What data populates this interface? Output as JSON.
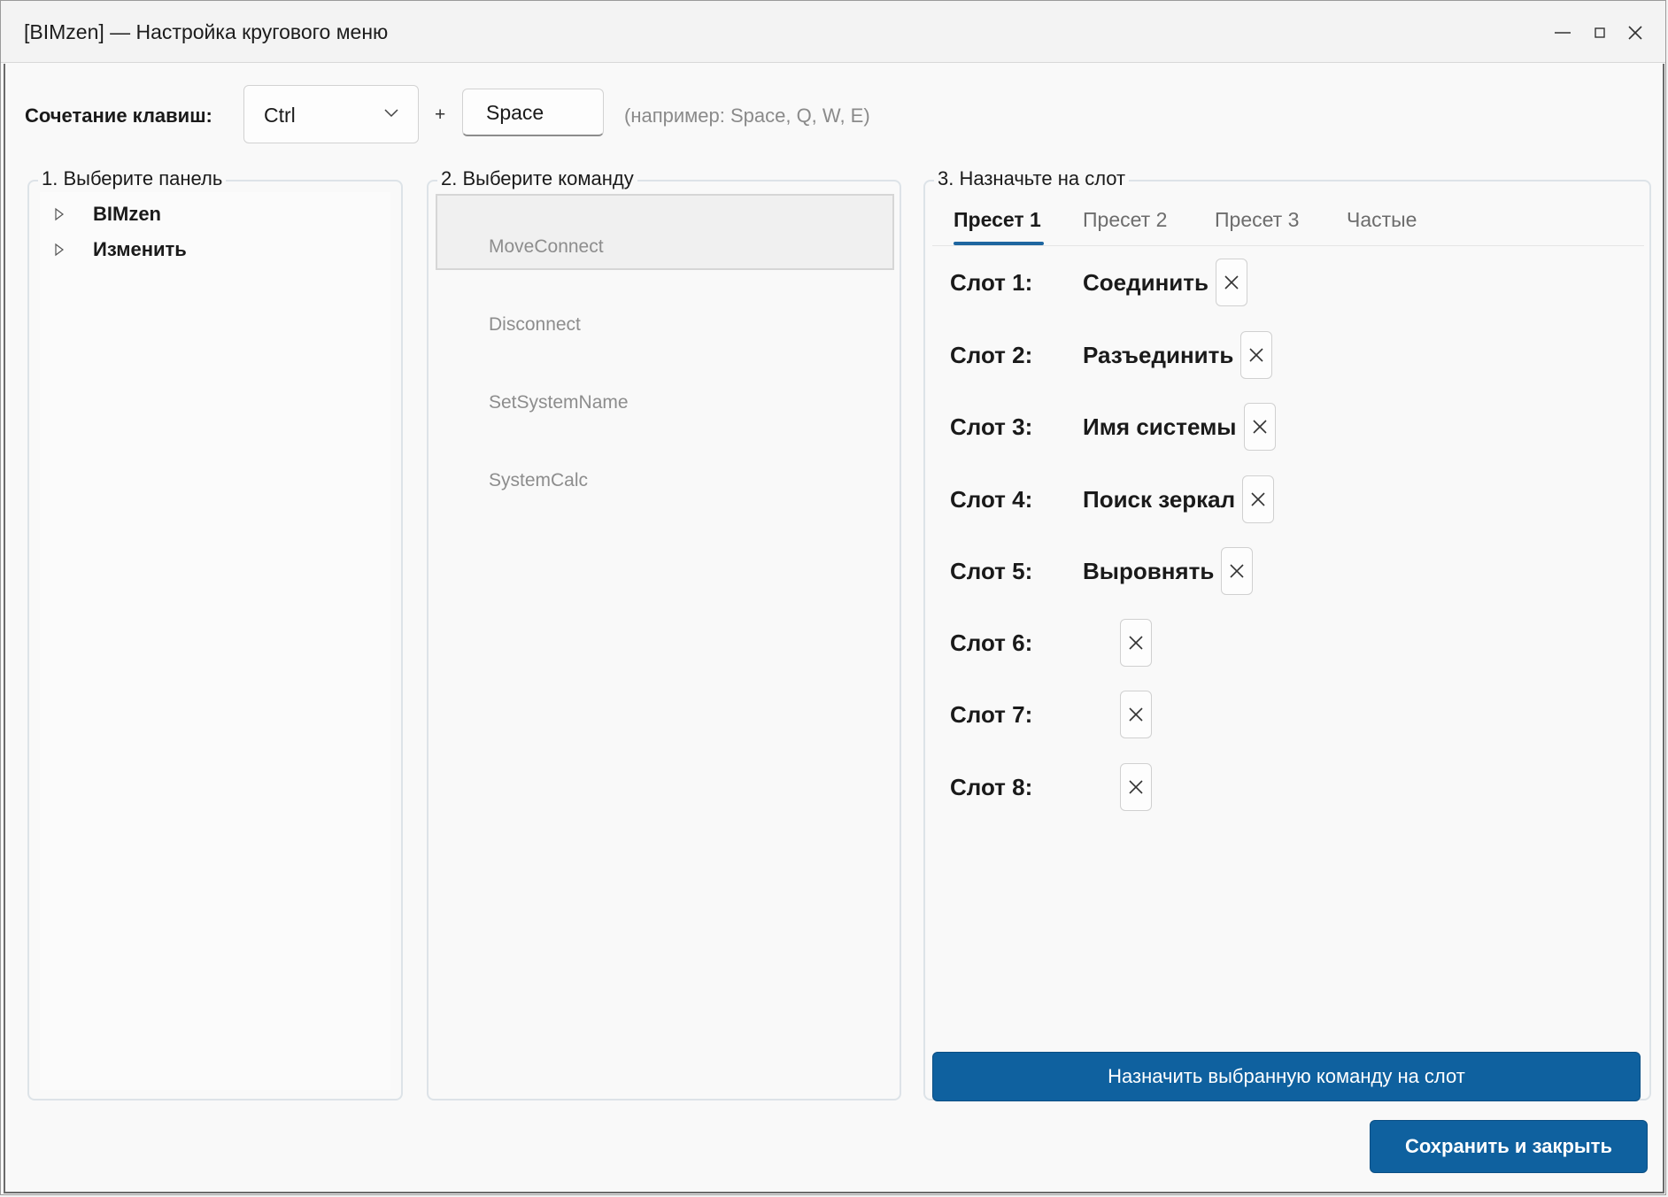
{
  "window": {
    "title": "[BIMzen] — Настройка кругового меню"
  },
  "hotkey": {
    "label": "Сочетание клавиш:",
    "modifier": "Ctrl",
    "plus": "+",
    "key": "Space",
    "hint": "(например: Space, Q, W, E)"
  },
  "panels": {
    "legend": "1. Выберите панель",
    "items": [
      {
        "label": "BIMzen"
      },
      {
        "label": "Изменить"
      }
    ]
  },
  "commands": {
    "legend": "2. Выберите команду",
    "items": [
      {
        "label": "MoveConnect",
        "selected": true
      },
      {
        "label": "Disconnect"
      },
      {
        "label": "SetSystemName"
      },
      {
        "label": "SystemCalc"
      }
    ]
  },
  "slots": {
    "legend": "3. Назначьте на слот",
    "tabs": [
      {
        "label": "Пресет 1",
        "active": true
      },
      {
        "label": "Пресет 2"
      },
      {
        "label": "Пресет 3"
      },
      {
        "label": "Частые"
      }
    ],
    "items": [
      {
        "label": "Слот 1:",
        "value": "Соединить"
      },
      {
        "label": "Слот 2:",
        "value": "Разъединить"
      },
      {
        "label": "Слот 3:",
        "value": "Имя системы"
      },
      {
        "label": "Слот 4:",
        "value": "Поиск зеркал"
      },
      {
        "label": "Слот 5:",
        "value": "Выровнять"
      },
      {
        "label": "Слот 6:",
        "value": ""
      },
      {
        "label": "Слот 7:",
        "value": ""
      },
      {
        "label": "Слот 8:",
        "value": ""
      }
    ],
    "assign_button": "Назначить выбранную команду на слот"
  },
  "footer": {
    "save_button": "Сохранить и закрыть"
  },
  "icons": {
    "minimize": "minimize-icon",
    "maximize": "maximize-icon",
    "close": "close-icon",
    "dropdown": "chevron-down-icon",
    "expand": "expand-triangle-icon",
    "clear": "clear-x-icon"
  },
  "colors": {
    "accent": "#0f619f",
    "tab_underline": "#1e66a0"
  }
}
